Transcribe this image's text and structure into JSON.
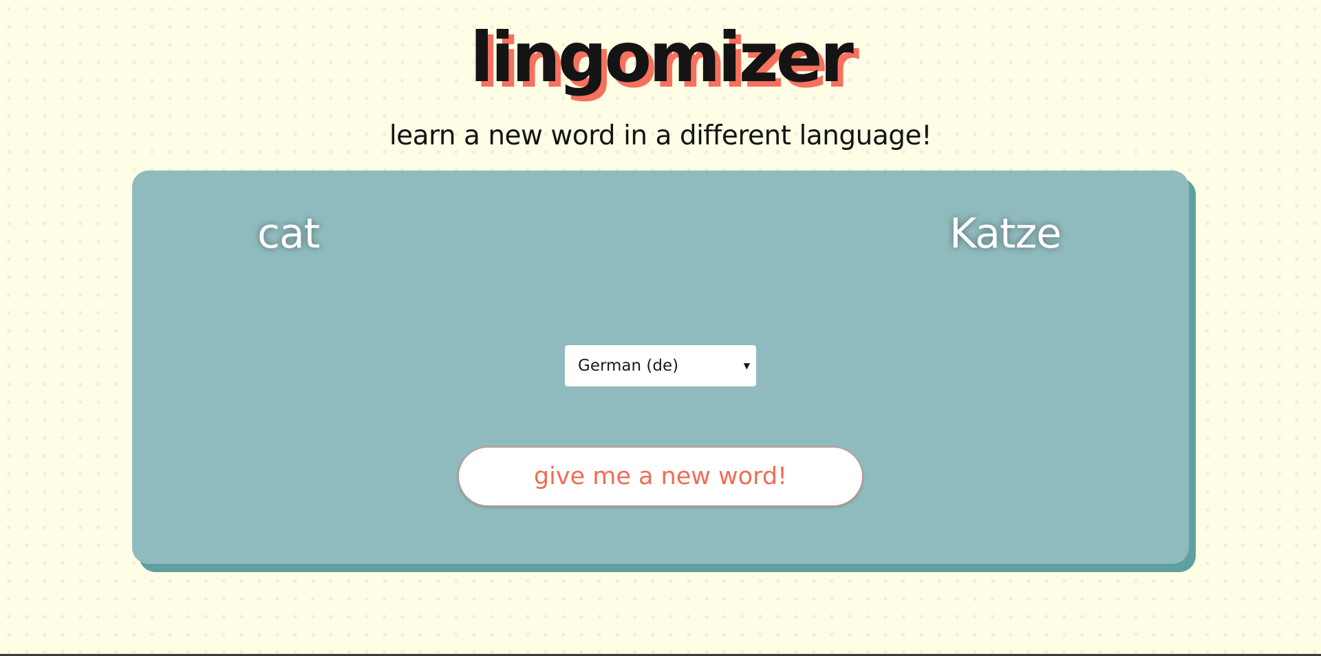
{
  "header": {
    "title": "lingomizer",
    "subtitle": "learn a new word in a different language!"
  },
  "card": {
    "source_word": "cat",
    "translated_word": "Katze",
    "language_select": {
      "selected": "German (de)"
    },
    "new_word_button_label": "give me a new word!"
  },
  "colors": {
    "background": "#fefee6",
    "title_shadow": "#f7705e",
    "card": "#90bbbe",
    "card_shadow": "#61a0a1",
    "button_text": "#f26b55"
  }
}
